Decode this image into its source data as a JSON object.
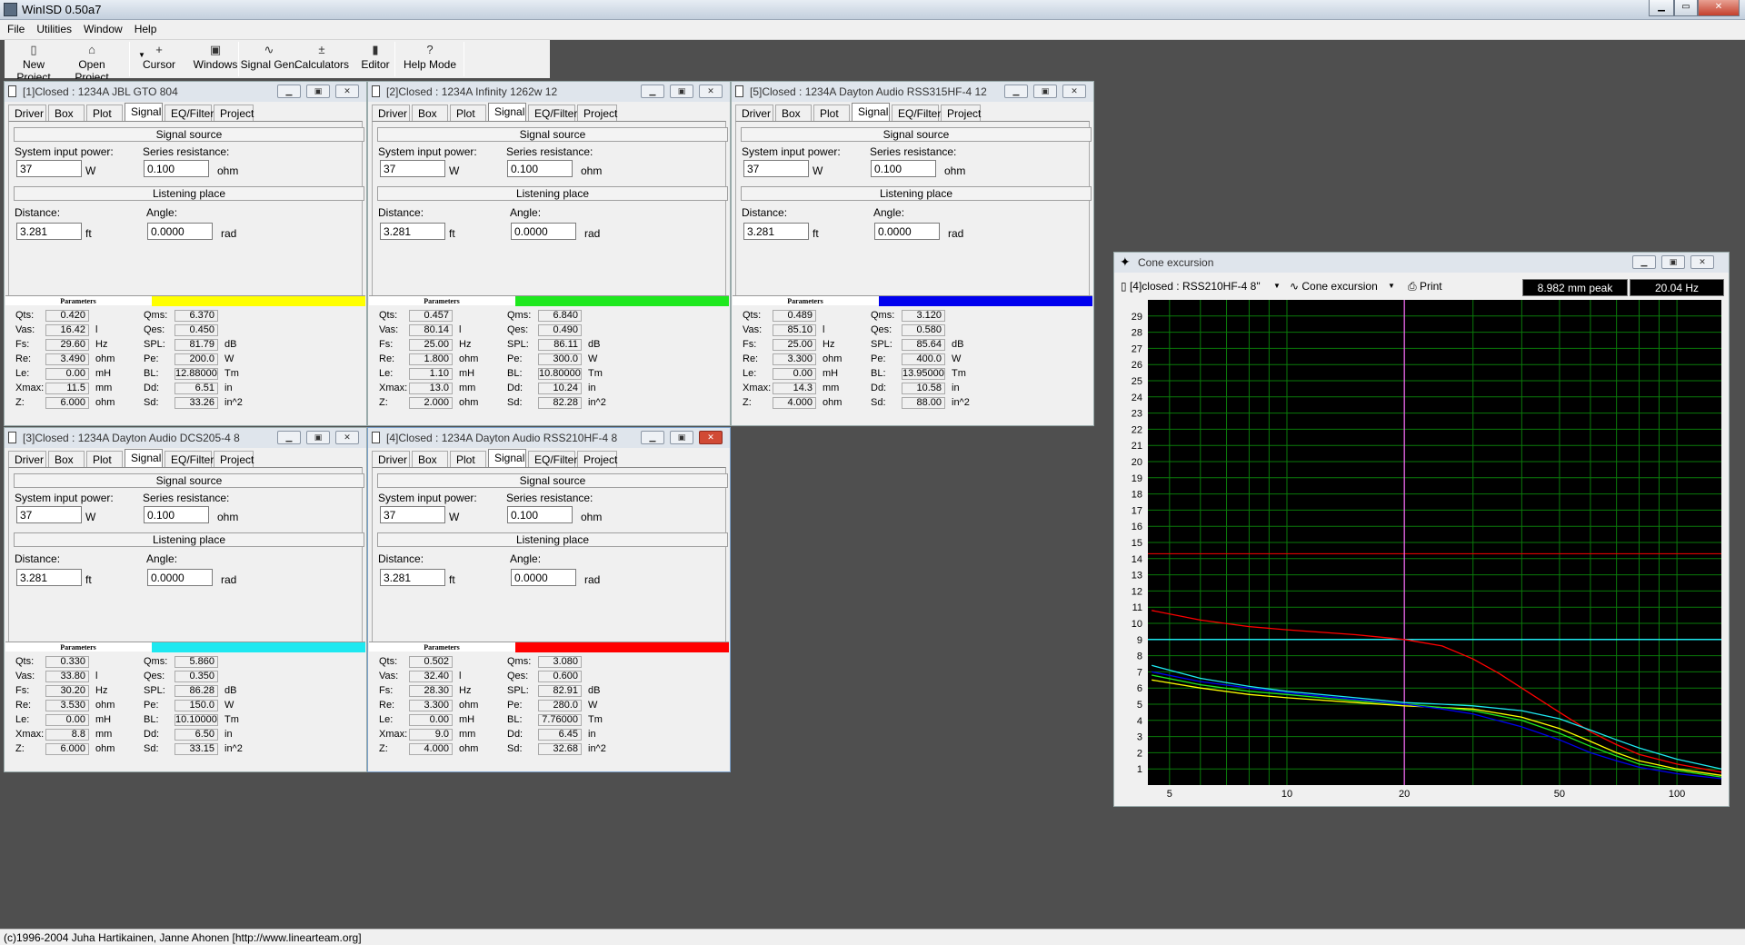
{
  "app": {
    "title": "WinISD 0.50a7"
  },
  "menu": [
    "File",
    "Utilities",
    "Window",
    "Help"
  ],
  "toolbar": [
    {
      "label": "New Project",
      "icon": "new-project-icon",
      "glyph": "▯"
    },
    {
      "label": "Open Project",
      "icon": "open-project-icon",
      "glyph": "⌂"
    },
    {
      "label": "Cursor",
      "icon": "cursor-icon",
      "glyph": "+"
    },
    {
      "label": "Windows",
      "icon": "windows-icon",
      "glyph": "▣"
    },
    {
      "label": "Signal Gen.",
      "icon": "signal-gen-icon",
      "glyph": "∿"
    },
    {
      "label": "Calculators",
      "icon": "calculators-icon",
      "glyph": "±"
    },
    {
      "label": "Editor",
      "icon": "editor-icon",
      "glyph": "▮"
    },
    {
      "label": "Help Mode",
      "icon": "help-icon",
      "glyph": "?"
    }
  ],
  "tabs": [
    "Driver",
    "Box",
    "Plot",
    "Signal",
    "EQ/Filter",
    "Project"
  ],
  "labels": {
    "signal_source": "Signal source",
    "system_input_power": "System input power:",
    "series_resistance": "Series resistance:",
    "listening_place": "Listening place",
    "distance": "Distance:",
    "angle": "Angle:",
    "parameters": "Parameters",
    "unit_w": "W",
    "unit_ohm": "ohm",
    "unit_ft": "ft",
    "unit_rad": "rad"
  },
  "param_rows": [
    {
      "l": "Qts:",
      "lu": "",
      "r": "Qms:",
      "ru": ""
    },
    {
      "l": "Vas:",
      "lu": "l",
      "r": "Qes:",
      "ru": ""
    },
    {
      "l": "Fs:",
      "lu": "Hz",
      "r": "SPL:",
      "ru": "dB"
    },
    {
      "l": "Re:",
      "lu": "ohm",
      "r": "Pe:",
      "ru": "W"
    },
    {
      "l": "Le:",
      "lu": "mH",
      "r": "BL:",
      "ru": "Tm"
    },
    {
      "l": "Xmax:",
      "lu": "mm",
      "r": "Dd:",
      "ru": "in"
    },
    {
      "l": "Z:",
      "lu": "ohm",
      "r": "Sd:",
      "ru": "in^2"
    }
  ],
  "drivers": [
    {
      "id": "1",
      "title": "[1]Closed : 1234A JBL GTO 804",
      "color": "#ffff00",
      "power": "37",
      "resistance": "0.100",
      "distance": "3.281",
      "angle": "0.0000",
      "active": false,
      "left": [
        "0.420",
        "16.42",
        "29.60",
        "3.490",
        "0.00",
        "11.5",
        "6.000"
      ],
      "right": [
        "6.370",
        "0.450",
        "81.79",
        "200.0",
        "12.88000",
        "6.51",
        "33.26"
      ]
    },
    {
      "id": "2",
      "title": "[2]Closed : 1234A Infinity 1262w 12",
      "color": "#1ee81e",
      "power": "37",
      "resistance": "0.100",
      "distance": "3.281",
      "angle": "0.0000",
      "active": false,
      "left": [
        "0.457",
        "80.14",
        "25.00",
        "1.800",
        "1.10",
        "13.0",
        "2.000"
      ],
      "right": [
        "6.840",
        "0.490",
        "86.11",
        "300.0",
        "10.80000",
        "10.24",
        "82.28"
      ]
    },
    {
      "id": "5",
      "title": "[5]Closed : 1234A Dayton Audio RSS315HF-4 12",
      "color": "#0000ee",
      "power": "37",
      "resistance": "0.100",
      "distance": "3.281",
      "angle": "0.0000",
      "active": false,
      "left": [
        "0.489",
        "85.10",
        "25.00",
        "3.300",
        "0.00",
        "14.3",
        "4.000"
      ],
      "right": [
        "3.120",
        "0.580",
        "85.64",
        "400.0",
        "13.95000",
        "10.58",
        "88.00"
      ]
    },
    {
      "id": "3",
      "title": "[3]Closed : 1234A Dayton Audio DCS205-4 8",
      "color": "#1ee8f0",
      "power": "37",
      "resistance": "0.100",
      "distance": "3.281",
      "angle": "0.0000",
      "active": false,
      "left": [
        "0.330",
        "33.80",
        "30.20",
        "3.530",
        "0.00",
        "8.8",
        "6.000"
      ],
      "right": [
        "5.860",
        "0.350",
        "86.28",
        "150.0",
        "10.10000",
        "6.50",
        "33.15"
      ]
    },
    {
      "id": "4",
      "title": "[4]Closed : 1234A Dayton Audio RSS210HF-4 8",
      "color": "#ff0000",
      "power": "37",
      "resistance": "0.100",
      "distance": "3.281",
      "angle": "0.0000",
      "active": true,
      "left": [
        "0.502",
        "32.40",
        "28.30",
        "3.300",
        "0.00",
        "9.0",
        "4.000"
      ],
      "right": [
        "3.080",
        "0.600",
        "82.91",
        "280.0",
        "7.76000",
        "6.45",
        "32.68"
      ]
    }
  ],
  "plot": {
    "title": "Cone excursion",
    "project_select": "[4]closed : RSS210HF-4 8\"",
    "mode_select": "Cone excursion",
    "print_label": "Print",
    "readout_value": "8.982 mm peak",
    "readout_freq": "20.04 Hz",
    "cursor_freq": 20,
    "hline_cyan": 9,
    "hline_red": 14.3
  },
  "chart_data": {
    "type": "line",
    "title": "Cone excursion",
    "xscale": "log",
    "xlim": [
      4.4,
      130
    ],
    "ylim": [
      0,
      30
    ],
    "x_ticks": [
      5,
      10,
      20,
      50,
      100
    ],
    "y_ticks": [
      1,
      2,
      3,
      4,
      5,
      6,
      7,
      8,
      9,
      10,
      11,
      12,
      13,
      14,
      15,
      16,
      17,
      18,
      19,
      20,
      21,
      22,
      23,
      24,
      25,
      26,
      27,
      28,
      29
    ],
    "grid": true,
    "series": [
      {
        "color": "#ff0000",
        "points": [
          [
            4.5,
            10.8
          ],
          [
            6,
            10.2
          ],
          [
            8,
            9.8
          ],
          [
            10,
            9.6
          ],
          [
            15,
            9.3
          ],
          [
            20,
            9.0
          ],
          [
            25,
            8.6
          ],
          [
            30,
            7.8
          ],
          [
            35,
            6.9
          ],
          [
            40,
            6.0
          ],
          [
            50,
            4.5
          ],
          [
            60,
            3.3
          ],
          [
            70,
            2.5
          ],
          [
            80,
            1.9
          ],
          [
            100,
            1.3
          ],
          [
            130,
            0.8
          ]
        ]
      },
      {
        "color": "#ffff00",
        "points": [
          [
            4.5,
            6.5
          ],
          [
            6,
            6.0
          ],
          [
            8,
            5.6
          ],
          [
            10,
            5.4
          ],
          [
            15,
            5.1
          ],
          [
            20,
            4.9
          ],
          [
            25,
            4.8
          ],
          [
            30,
            4.7
          ],
          [
            40,
            4.2
          ],
          [
            50,
            3.5
          ],
          [
            60,
            2.7
          ],
          [
            70,
            2.0
          ],
          [
            80,
            1.5
          ],
          [
            100,
            1.0
          ],
          [
            130,
            0.6
          ]
        ]
      },
      {
        "color": "#1ee81e",
        "points": [
          [
            4.5,
            6.8
          ],
          [
            6,
            6.2
          ],
          [
            8,
            5.8
          ],
          [
            10,
            5.6
          ],
          [
            15,
            5.2
          ],
          [
            20,
            5.0
          ],
          [
            25,
            4.8
          ],
          [
            30,
            4.6
          ],
          [
            40,
            4.0
          ],
          [
            50,
            3.2
          ],
          [
            60,
            2.4
          ],
          [
            70,
            1.8
          ],
          [
            80,
            1.3
          ],
          [
            100,
            0.9
          ],
          [
            130,
            0.5
          ]
        ]
      },
      {
        "color": "#0000ee",
        "points": [
          [
            4.5,
            7.0
          ],
          [
            6,
            6.4
          ],
          [
            8,
            6.0
          ],
          [
            10,
            5.7
          ],
          [
            15,
            5.3
          ],
          [
            20,
            5.0
          ],
          [
            25,
            4.7
          ],
          [
            30,
            4.4
          ],
          [
            40,
            3.6
          ],
          [
            50,
            2.8
          ],
          [
            60,
            2.0
          ],
          [
            70,
            1.5
          ],
          [
            80,
            1.1
          ],
          [
            100,
            0.7
          ],
          [
            130,
            0.4
          ]
        ]
      },
      {
        "color": "#1ee8f0",
        "points": [
          [
            4.5,
            7.4
          ],
          [
            6,
            6.6
          ],
          [
            8,
            6.1
          ],
          [
            10,
            5.8
          ],
          [
            15,
            5.4
          ],
          [
            20,
            5.1
          ],
          [
            25,
            5.0
          ],
          [
            30,
            4.9
          ],
          [
            40,
            4.6
          ],
          [
            50,
            4.1
          ],
          [
            60,
            3.4
          ],
          [
            70,
            2.8
          ],
          [
            80,
            2.3
          ],
          [
            100,
            1.6
          ],
          [
            130,
            1.0
          ]
        ]
      }
    ]
  },
  "status": "(c)1996-2004 Juha Hartikainen, Janne Ahonen [http://www.linearteam.org]"
}
